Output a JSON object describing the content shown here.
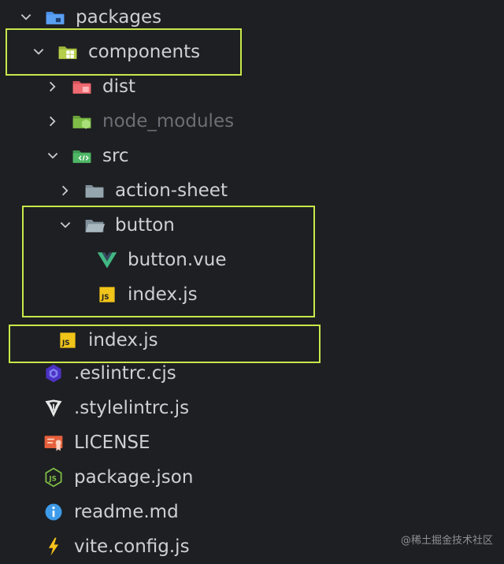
{
  "explorer": {
    "items": [
      {
        "label": "packages"
      },
      {
        "label": "components"
      },
      {
        "label": "dist"
      },
      {
        "label": "node_modules"
      },
      {
        "label": "src"
      },
      {
        "label": "action-sheet"
      },
      {
        "label": "button"
      },
      {
        "label": "button.vue"
      },
      {
        "label": "index.js"
      },
      {
        "label": "index.js"
      },
      {
        "label": ".eslintrc.cjs"
      },
      {
        "label": ".stylelintrc.js"
      },
      {
        "label": "LICENSE"
      },
      {
        "label": "package.json"
      },
      {
        "label": "readme.md"
      },
      {
        "label": "vite.config.js"
      }
    ]
  },
  "watermark": "@稀土掘金技术社区",
  "colors": {
    "background": "#1e1f22",
    "highlight": "#c7e84a",
    "text": "#cdd0d4",
    "dim_text": "#6b6f75"
  }
}
